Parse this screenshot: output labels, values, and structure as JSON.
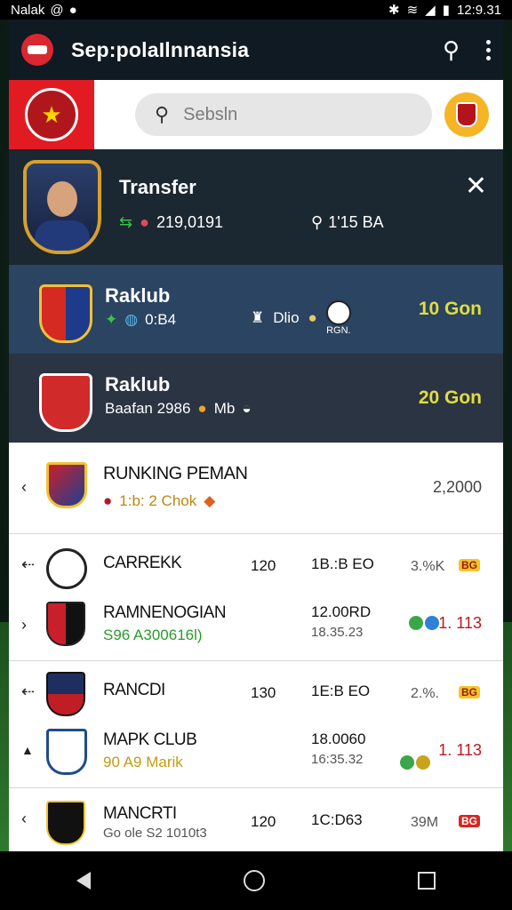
{
  "status": {
    "left": "Nalak",
    "time": "12:9.31"
  },
  "app": {
    "title": "Sep:polaIlnnansia"
  },
  "search": {
    "placeholder": "Sebsln"
  },
  "transfer": {
    "title": "Transfer",
    "stat1": "219,0191",
    "stat2": "1'15 BA"
  },
  "clubs": [
    {
      "name": "Raklub",
      "sub": "0:B4",
      "mid_text": "Dlio",
      "ball_label": "RGN.",
      "amount": "10 Gon"
    },
    {
      "name": "Raklub",
      "sub": "Baafan 2986",
      "mid_text": "Mb",
      "amount": "20 Gon"
    }
  ],
  "ranking": {
    "title": "RUNKING PEMAN",
    "sub": "1:b: 2 Chok",
    "value": "2,2000"
  },
  "matches": [
    {
      "name": "CARREKK",
      "c1": "120",
      "c2": "1B.:B EO",
      "pct": "3.%K",
      "tag": "BG"
    },
    {
      "name": "RAMNENOGIAN",
      "sub": "S96  A300616l)",
      "c2": "12.00RD",
      "c2b": "18.35.23",
      "score": "1. 113"
    },
    {
      "name": "RANCDI",
      "c1": "130",
      "c2": "1E:B EO",
      "pct": "2.%.",
      "tag": "BG"
    },
    {
      "name": "MAPK CLUB",
      "sub": "90  A9 Marik",
      "c2": "18.0060",
      "c2b": "16:35.32",
      "score": "1. 113"
    },
    {
      "name": "MANCRTI",
      "sub": "Go ole S2 1010t3",
      "c1": "120",
      "c2": "1C:D63",
      "pct": "39M",
      "tag": "BG"
    }
  ]
}
